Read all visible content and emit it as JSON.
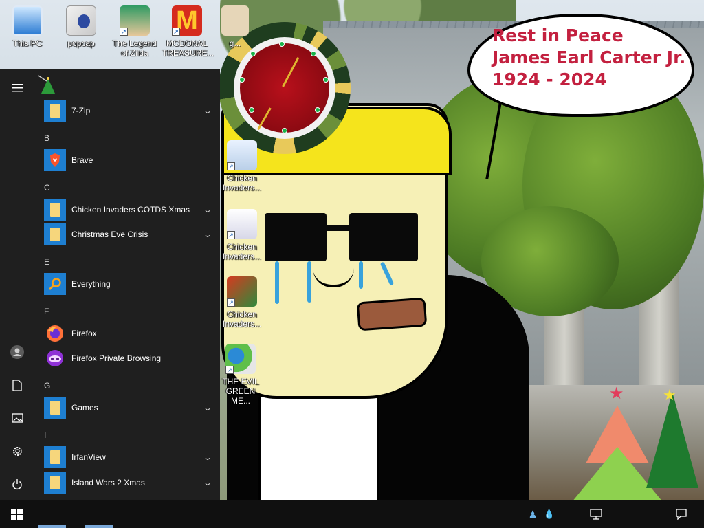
{
  "desktop": {
    "icons": [
      {
        "name": "this-pc",
        "label": "This PC"
      },
      {
        "name": "popcap",
        "label": "popcap"
      },
      {
        "name": "legend-of-zilda",
        "label": "The Legend of Zilda"
      },
      {
        "name": "mcdonalds-treasure",
        "label": "MCDONAL TREASURE..."
      },
      {
        "name": "gadget",
        "label": "g..."
      },
      {
        "name": "chicken-invaders-1",
        "label": "Chicken Invaders..."
      },
      {
        "name": "chicken-invaders-2",
        "label": "Chicken Invaders..."
      },
      {
        "name": "chicken-invaders-3",
        "label": "Chicken Invaders..."
      },
      {
        "name": "evil-green-me",
        "label": "THE EVIL GREEN ME..."
      }
    ],
    "bubble": {
      "line1": "Rest in Peace",
      "line2": "James Earl Carter Jr.",
      "line3": "1924 - 2024"
    },
    "bubble_color": "#c3203f"
  },
  "start_menu": {
    "rail": {
      "menu_icon": "hamburger-icon",
      "user_icon": "user-icon",
      "documents_icon": "document-icon",
      "pictures_icon": "pictures-icon",
      "settings_icon": "gear-icon",
      "power_icon": "power-icon"
    },
    "items": [
      {
        "type": "app",
        "label": "7-Zip",
        "icon": "folder",
        "expandable": true
      },
      {
        "type": "header",
        "label": "B"
      },
      {
        "type": "app",
        "label": "Brave",
        "icon": "brave",
        "expandable": false
      },
      {
        "type": "header",
        "label": "C"
      },
      {
        "type": "app",
        "label": "Chicken Invaders COTDS Xmas",
        "icon": "folder",
        "expandable": true
      },
      {
        "type": "app",
        "label": "Christmas Eve Crisis",
        "icon": "folder",
        "expandable": true
      },
      {
        "type": "header",
        "label": "E"
      },
      {
        "type": "app",
        "label": "Everything",
        "icon": "everything",
        "expandable": false
      },
      {
        "type": "header",
        "label": "F"
      },
      {
        "type": "app",
        "label": "Firefox",
        "icon": "firefox",
        "expandable": false
      },
      {
        "type": "app",
        "label": "Firefox Private Browsing",
        "icon": "firefox-private",
        "expandable": false
      },
      {
        "type": "header",
        "label": "G"
      },
      {
        "type": "app",
        "label": "Games",
        "icon": "folder",
        "expandable": true
      },
      {
        "type": "header",
        "label": "I"
      },
      {
        "type": "app",
        "label": "IrfanView",
        "icon": "folder",
        "expandable": true
      },
      {
        "type": "app",
        "label": "Island Wars 2 Xmas",
        "icon": "folder",
        "expandable": true
      }
    ],
    "accent_color": "#1e7fd1"
  },
  "taskbar": {
    "start_icon": "windows-logo-icon",
    "tray_icons": [
      "network-icon",
      "volume-icon",
      "notification-icon"
    ]
  }
}
